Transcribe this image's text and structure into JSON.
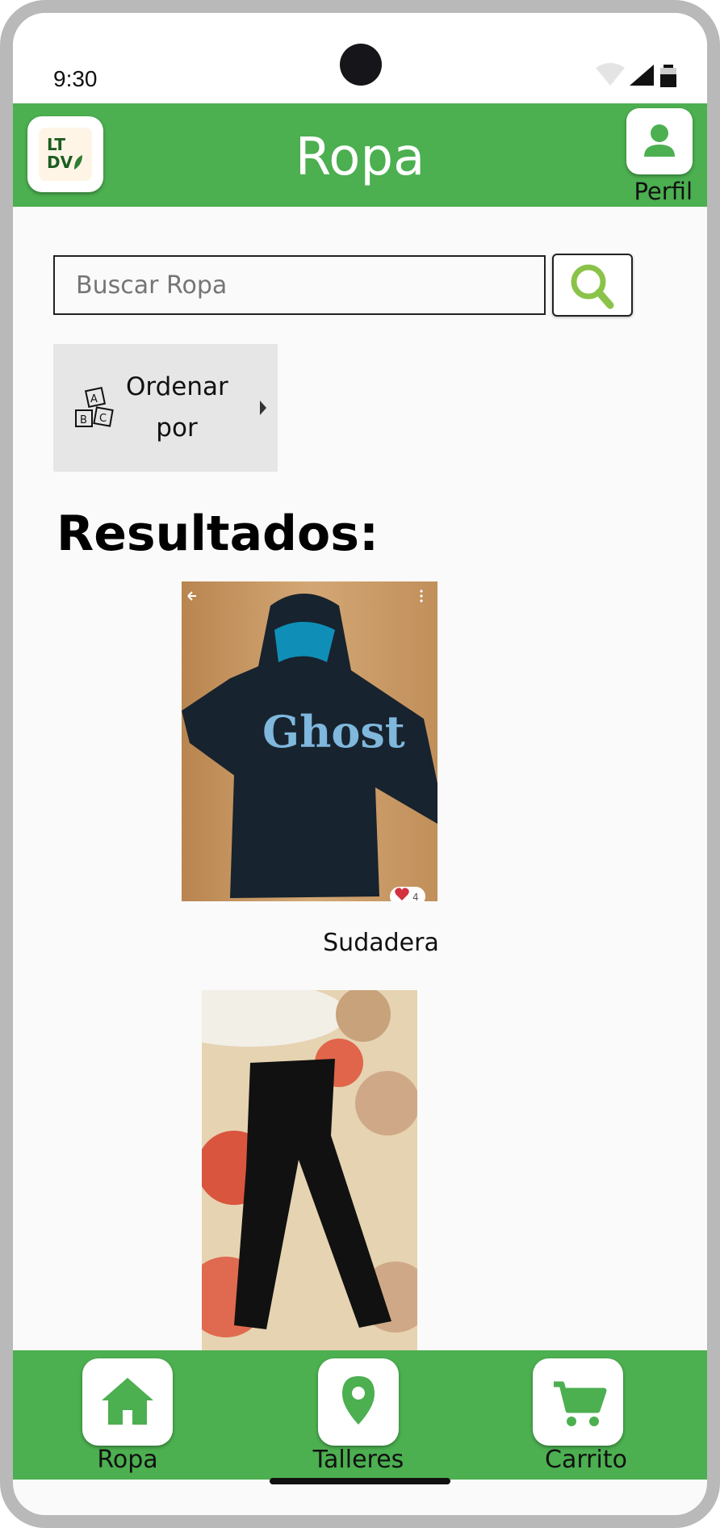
{
  "status_bar": {
    "time": "9:30"
  },
  "header": {
    "title": "Ropa",
    "logo_text_line1": "LT",
    "logo_text_line2": "DV",
    "profile_label": "Perfil"
  },
  "search": {
    "placeholder": "Buscar Ropa"
  },
  "sort": {
    "label_line1": "Ordenar",
    "label_line2": "por"
  },
  "results": {
    "title": "Resultados:",
    "items": [
      {
        "name": "Sudadera",
        "likes": "4",
        "print_text": "Ghost"
      },
      {
        "name": ""
      }
    ]
  },
  "bottom_nav": {
    "items": [
      {
        "label": "Ropa",
        "icon": "home-icon"
      },
      {
        "label": "Talleres",
        "icon": "location-pin-icon"
      },
      {
        "label": "Carrito",
        "icon": "cart-icon"
      }
    ]
  },
  "colors": {
    "primary": "#4caf50",
    "search_icon": "#8bc34a",
    "frame": "#b9b9b9"
  }
}
